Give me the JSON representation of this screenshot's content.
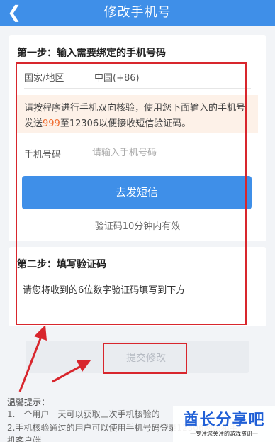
{
  "header": {
    "back_icon": "chevron-left-icon",
    "title": "修改手机号",
    "bg_color": "#3f8fe8"
  },
  "step1": {
    "title": "第一步：输入需要绑定的手机号码",
    "country_label": "国家/地区",
    "country_value": "中国(+86)",
    "notice_part1": "请按程序进行手机双向核验，使用您下面输入的手机号发送",
    "notice_highlight": "999",
    "notice_part2": "至12306以便接收短信验证码。",
    "highlight_color": "#ef6b2e",
    "phone_label": "手机号码",
    "phone_placeholder": "请输入手机号码",
    "phone_value": "",
    "send_button": "去发短信",
    "valid_tip": "验证码10分钟内有效"
  },
  "step2": {
    "title": "第二步：填写验证码",
    "desc": "请您将收到的6位数字验证码填写到下方",
    "code_digits": [
      "",
      "",
      "",
      "",
      "",
      ""
    ]
  },
  "submit_button": "提交修改",
  "tips": {
    "title": "温馨提示：",
    "line1": "1.一个用户一天可以获取三次手机核验的",
    "line2": "2.手机核验通过的用户可以使用手机号码登录12306网站和手",
    "line3": "机客户端"
  },
  "watermark": {
    "main": "酋长分享吧",
    "sub": "一专注您关注的游戏资讯一"
  }
}
